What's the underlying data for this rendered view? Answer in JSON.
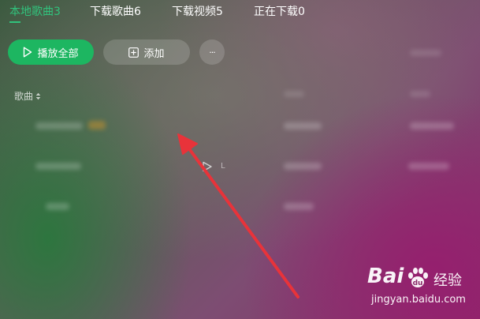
{
  "tabs": [
    {
      "label": "本地歌曲3",
      "active": true
    },
    {
      "label": "下载歌曲6",
      "active": false
    },
    {
      "label": "下载视频5",
      "active": false
    },
    {
      "label": "正在下载0",
      "active": false
    }
  ],
  "toolbar": {
    "play_all_label": "播放全部",
    "add_label": "添加",
    "more_label": "···"
  },
  "table": {
    "column_song": "歌曲"
  },
  "row_fragment": "L",
  "watermark": {
    "brand": "Bai",
    "brand_suffix": "du",
    "product": "经验",
    "url": "jingyan.baidu.com"
  },
  "colors": {
    "accent": "#31c27c",
    "play_button": "#1db661",
    "arrow": "#e8333a"
  }
}
